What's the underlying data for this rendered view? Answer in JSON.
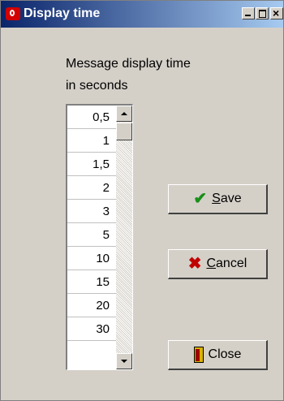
{
  "window": {
    "title": "Display time"
  },
  "label": {
    "line1": "Message display time",
    "line2": "in seconds"
  },
  "list": {
    "items": [
      "0,5",
      "1",
      "1,5",
      "2",
      "3",
      "5",
      "10",
      "15",
      "20",
      "30"
    ]
  },
  "buttons": {
    "save": {
      "accel": "S",
      "rest": "ave",
      "icon": "checkmark-icon"
    },
    "cancel": {
      "accel": "C",
      "rest": "ancel",
      "icon": "cross-icon"
    },
    "close": {
      "label": "Close",
      "icon": "door-icon"
    }
  },
  "colors": {
    "title_start": "#0a246a",
    "title_end": "#a6caf0",
    "face": "#d4d0c8",
    "check": "#1a8f1a",
    "cross": "#c00000"
  }
}
